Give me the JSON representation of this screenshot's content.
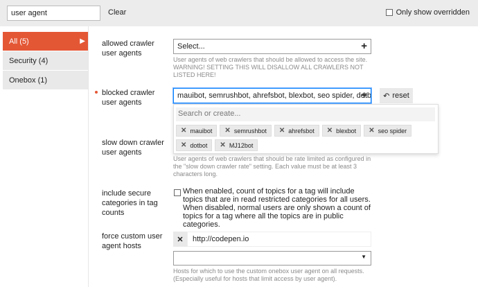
{
  "filter": {
    "value": "user agent",
    "clear_label": "Clear",
    "only_overridden_label": "Only show overridden"
  },
  "sidebar": {
    "items": [
      {
        "label": "All (5)",
        "active": true
      },
      {
        "label": "Security (4)",
        "active": false
      },
      {
        "label": "Onebox (1)",
        "active": false
      }
    ]
  },
  "settings": {
    "allowed": {
      "label": "allowed crawler user agents",
      "value": "Select...",
      "description": "User agents of web crawlers that should be allowed to access the site. WARNING! SETTING THIS WILL DISALLOW ALL CRAWLERS NOT LISTED HERE!"
    },
    "blocked": {
      "label": "blocked crawler user agents",
      "value": "mauibot, semrushbot, ahrefsbot, blexbot, seo spider, dotbot, ...",
      "reset_label": "reset",
      "search_placeholder": "Search or create...",
      "chips": [
        "mauibot",
        "semrushbot",
        "ahrefsbot",
        "blexbot",
        "seo spider",
        "dotbot",
        "MJ12bot"
      ]
    },
    "slow_down": {
      "label": "slow down crawler user agents",
      "description": "User agents of web crawlers that should be rate limited as configured in the \"slow down crawler rate\" setting. Each value must be at least 3 characters long."
    },
    "secure_categories": {
      "label": "include secure categories in tag counts",
      "description": "When enabled, count of topics for a tag will include topics that are in read restricted categories for all users. When disabled, normal users are only shown a count of topics for a tag where all the topics are in public categories."
    },
    "custom_hosts": {
      "label": "force custom user agent hosts",
      "host_value": "http://codepen.io",
      "description": "Hosts for which to use the custom onebox user agent on all requests. (Especially useful for hosts that limit access by user agent)."
    }
  },
  "colors": {
    "accent": "#e45735",
    "focus": "#0a84ff"
  }
}
